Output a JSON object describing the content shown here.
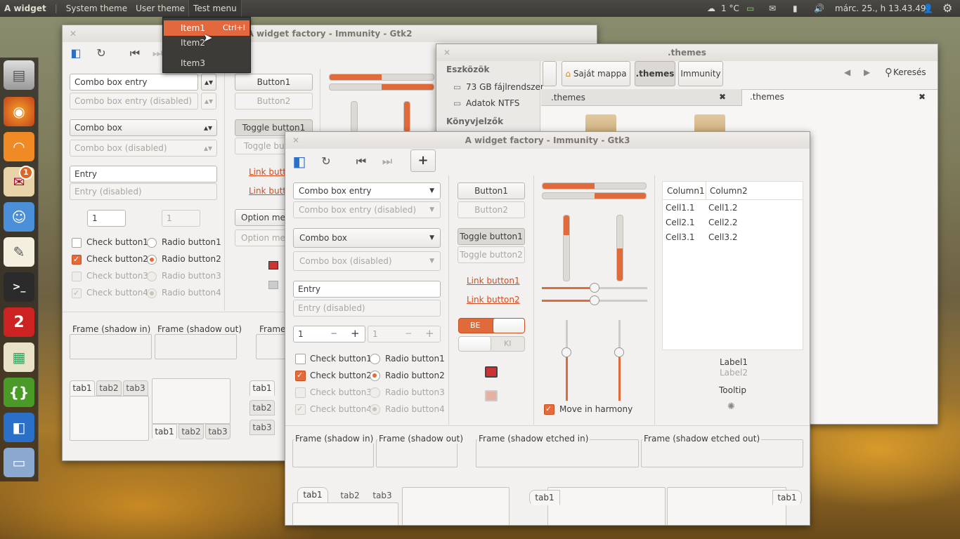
{
  "panel": {
    "app_name": "A widget",
    "menus": [
      "System theme",
      "User theme",
      "Test menu"
    ],
    "weather": "1 °C",
    "clock": "márc. 25., h 13.43.49"
  },
  "test_menu": {
    "items": [
      {
        "label": "Item1",
        "accel": "Ctrl+I"
      },
      {
        "label": "Item2"
      },
      {
        "label": "Item3"
      }
    ]
  },
  "launcher": {
    "notification_count": "1"
  },
  "gtk2": {
    "title": "A widget factory - Immunity - Gtk2",
    "combo_entry": "Combo box entry",
    "combo_entry_dis": "Combo box entry (disabled)",
    "combo": "Combo box",
    "combo_dis": "Combo box (disabled)",
    "entry": "Entry",
    "entry_dis": "Entry (disabled)",
    "spin": "1",
    "spin_dis": "1",
    "check1": "Check button1",
    "check2": "Check button2",
    "check3": "Check button3",
    "check4": "Check button4",
    "radio1": "Radio button1",
    "radio2": "Radio button2",
    "radio3": "Radio button3",
    "radio4": "Radio button4",
    "button1": "Button1",
    "button2": "Button2",
    "toggle1": "Toggle button1",
    "toggle2": "Toggle butt",
    "link1": "Link butt",
    "link2": "Link butt",
    "option1": "Option men",
    "option2": "Option men",
    "frame_in": "Frame (shadow in)",
    "frame_out": "Frame (shadow out)",
    "frame_trunc": "Frame",
    "tabs": [
      "tab1",
      "tab2",
      "tab3"
    ]
  },
  "files": {
    "title": ".themes",
    "sidebar_head1": "Eszközök",
    "drive1": "73 GB fájlrendszer",
    "drive2": "Adatok NTFS",
    "sidebar_head2": "Könyvjelzők",
    "crumb_home": "Saját mappa",
    "crumb_themes": ".themes",
    "crumb_immunity": "Immunity",
    "search": "Keresés",
    "tab1": ".themes",
    "tab2": ".themes"
  },
  "gtk3": {
    "title": "A widget factory - Immunity - Gtk3",
    "combo_entry": "Combo box entry",
    "combo_entry_dis": "Combo box entry (disabled)",
    "combo": "Combo box",
    "combo_dis": "Combo box (disabled)",
    "entry": "Entry",
    "entry_dis": "Entry (disabled)",
    "spin": "1",
    "spin_dis": "1",
    "check1": "Check button1",
    "check2": "Check button2",
    "check3": "Check button3",
    "check4": "Check button4",
    "radio1": "Radio button1",
    "radio2": "Radio button2",
    "radio3": "Radio button3",
    "radio4": "Radio button4",
    "button1": "Button1",
    "button2": "Button2",
    "toggle1": "Toggle button1",
    "toggle2": "Toggle button2",
    "link1": "Link button1",
    "link2": "Link button2",
    "switch_on": "BE",
    "switch_off": "KI",
    "move_harmony": "Move in harmony",
    "tree": {
      "columns": [
        "Column1",
        "Column2"
      ],
      "rows": [
        [
          "Cell1.1",
          "Cell1.2"
        ],
        [
          "Cell2.1",
          "Cell2.2"
        ],
        [
          "Cell3.1",
          "Cell3.2"
        ]
      ]
    },
    "label1": "Label1",
    "label2": "Label2",
    "tooltip": "Tooltip",
    "frame_in": "Frame (shadow in)",
    "frame_out": "Frame (shadow out)",
    "frame_etched_in": "Frame (shadow etched in)",
    "frame_etched_out": "Frame (shadow etched out)",
    "tabs": [
      "tab1",
      "tab2",
      "tab3"
    ],
    "side_tab": "tab1",
    "side_tab_right": "tab1",
    "progress": [
      0.5,
      0.5
    ],
    "vprogress": [
      0.3,
      0.5
    ],
    "hscale": [
      0.5,
      0.5
    ],
    "vscale": [
      0.4,
      0.4
    ]
  },
  "colors": {
    "accent": "#e06a3a",
    "panel": "#3c3b37"
  }
}
